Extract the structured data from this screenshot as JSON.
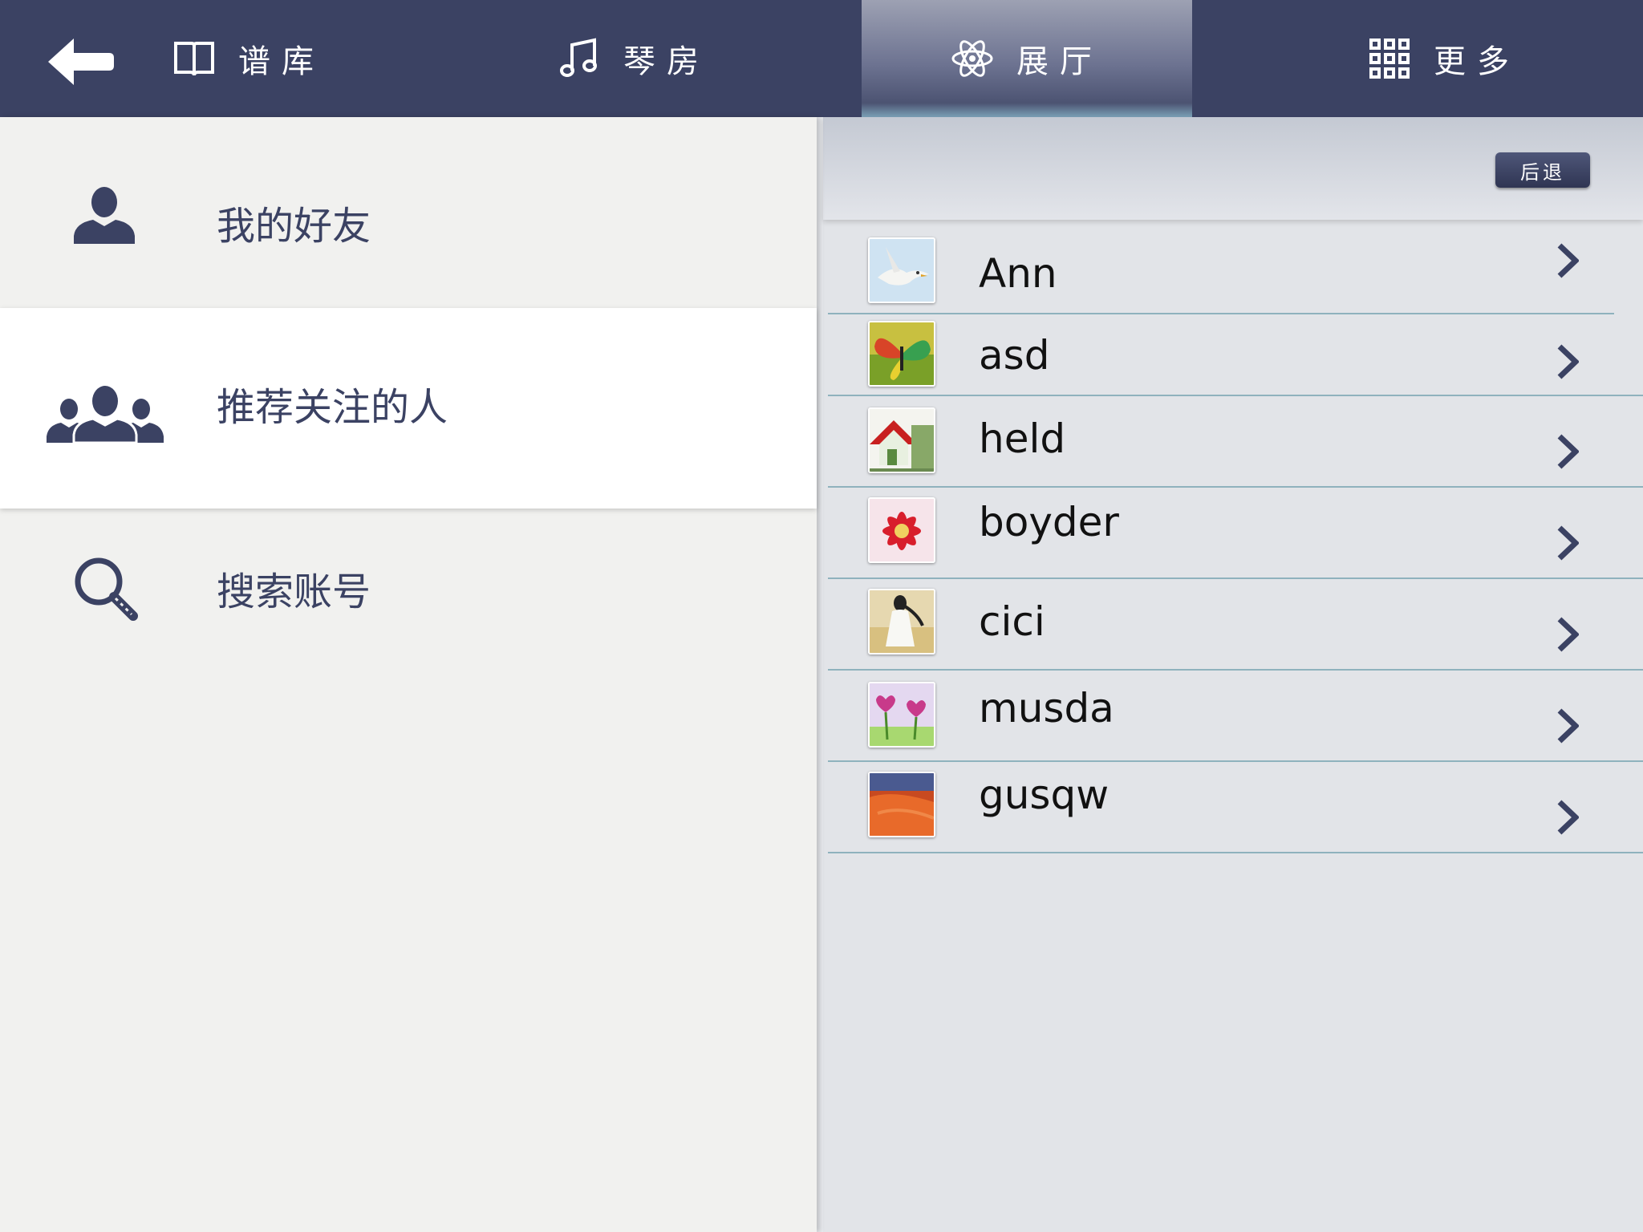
{
  "nav": {
    "tabs": [
      {
        "label": "谱库",
        "icon": "book-icon"
      },
      {
        "label": "琴房",
        "icon": "music-note-icon"
      },
      {
        "label": "展厅",
        "icon": "atom-icon",
        "active": true
      },
      {
        "label": "更多",
        "icon": "grid-icon"
      }
    ],
    "back_icon": "back-arrow-icon"
  },
  "sidebar": {
    "items": [
      {
        "label": "我的好友",
        "icon": "person-icon"
      },
      {
        "label": "推荐关注的人",
        "icon": "group-icon",
        "selected": true
      },
      {
        "label": "搜索账号",
        "icon": "search-icon"
      }
    ]
  },
  "content": {
    "back_label": "后退",
    "users": [
      {
        "name": "Ann",
        "avatar": "seagull"
      },
      {
        "name": "asd",
        "avatar": "butterfly"
      },
      {
        "name": "held",
        "avatar": "house"
      },
      {
        "name": "boyder",
        "avatar": "flower"
      },
      {
        "name": "cici",
        "avatar": "girl-in-field"
      },
      {
        "name": "musda",
        "avatar": "heart-flowers"
      },
      {
        "name": "gusqw",
        "avatar": "desert"
      }
    ]
  },
  "colors": {
    "nav_bg": "#3b4263",
    "accent_dark": "#3b4263",
    "row_divider": "#8fb2bd"
  }
}
